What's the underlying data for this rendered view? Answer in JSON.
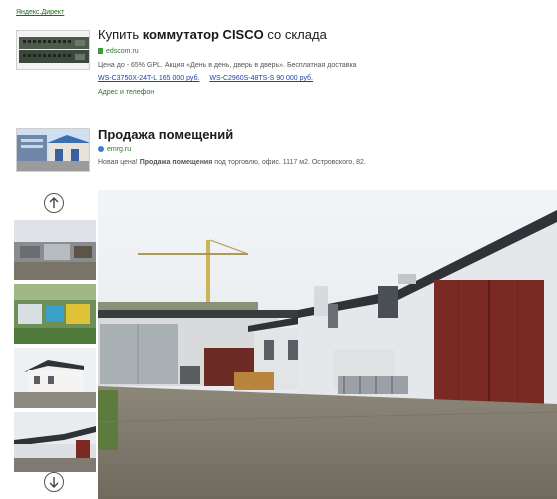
{
  "header": {
    "label": "Яндекс.Директ"
  },
  "ads": [
    {
      "title_pre": "Купить ",
      "title_bold": "коммутатор CISCO",
      "title_post": " со склада",
      "domain": "edscom.ru",
      "text": "Цена до - 65% GPL. Акция «День в день, дверь в дверь». Бесплатная доставка",
      "links": [
        "WS-C3750X-24T-L 165 000 руб.",
        "WS-C2960S-48TS-S 90 000 руб."
      ],
      "contacts": "Адрес и телефон"
    },
    {
      "title": "Продажа помещений",
      "domain": "emrg.ru",
      "text_pre": "Новая цена! ",
      "text_bold": "Продажа помещения",
      "text_post": " под торговлю, офис. 1117 м2. Островского, 82."
    }
  ],
  "gallery": {
    "up_icon": "arrow-up-icon",
    "down_icon": "arrow-down-icon",
    "thumbs": [
      "thumb-1",
      "thumb-2",
      "thumb-3",
      "thumb-4"
    ]
  },
  "colors": {
    "link": "#1d3fb0",
    "domain": "#2a7a2a",
    "roof": "#2f3236",
    "door": "#7a2a22",
    "wall": "#e6e7ea"
  }
}
